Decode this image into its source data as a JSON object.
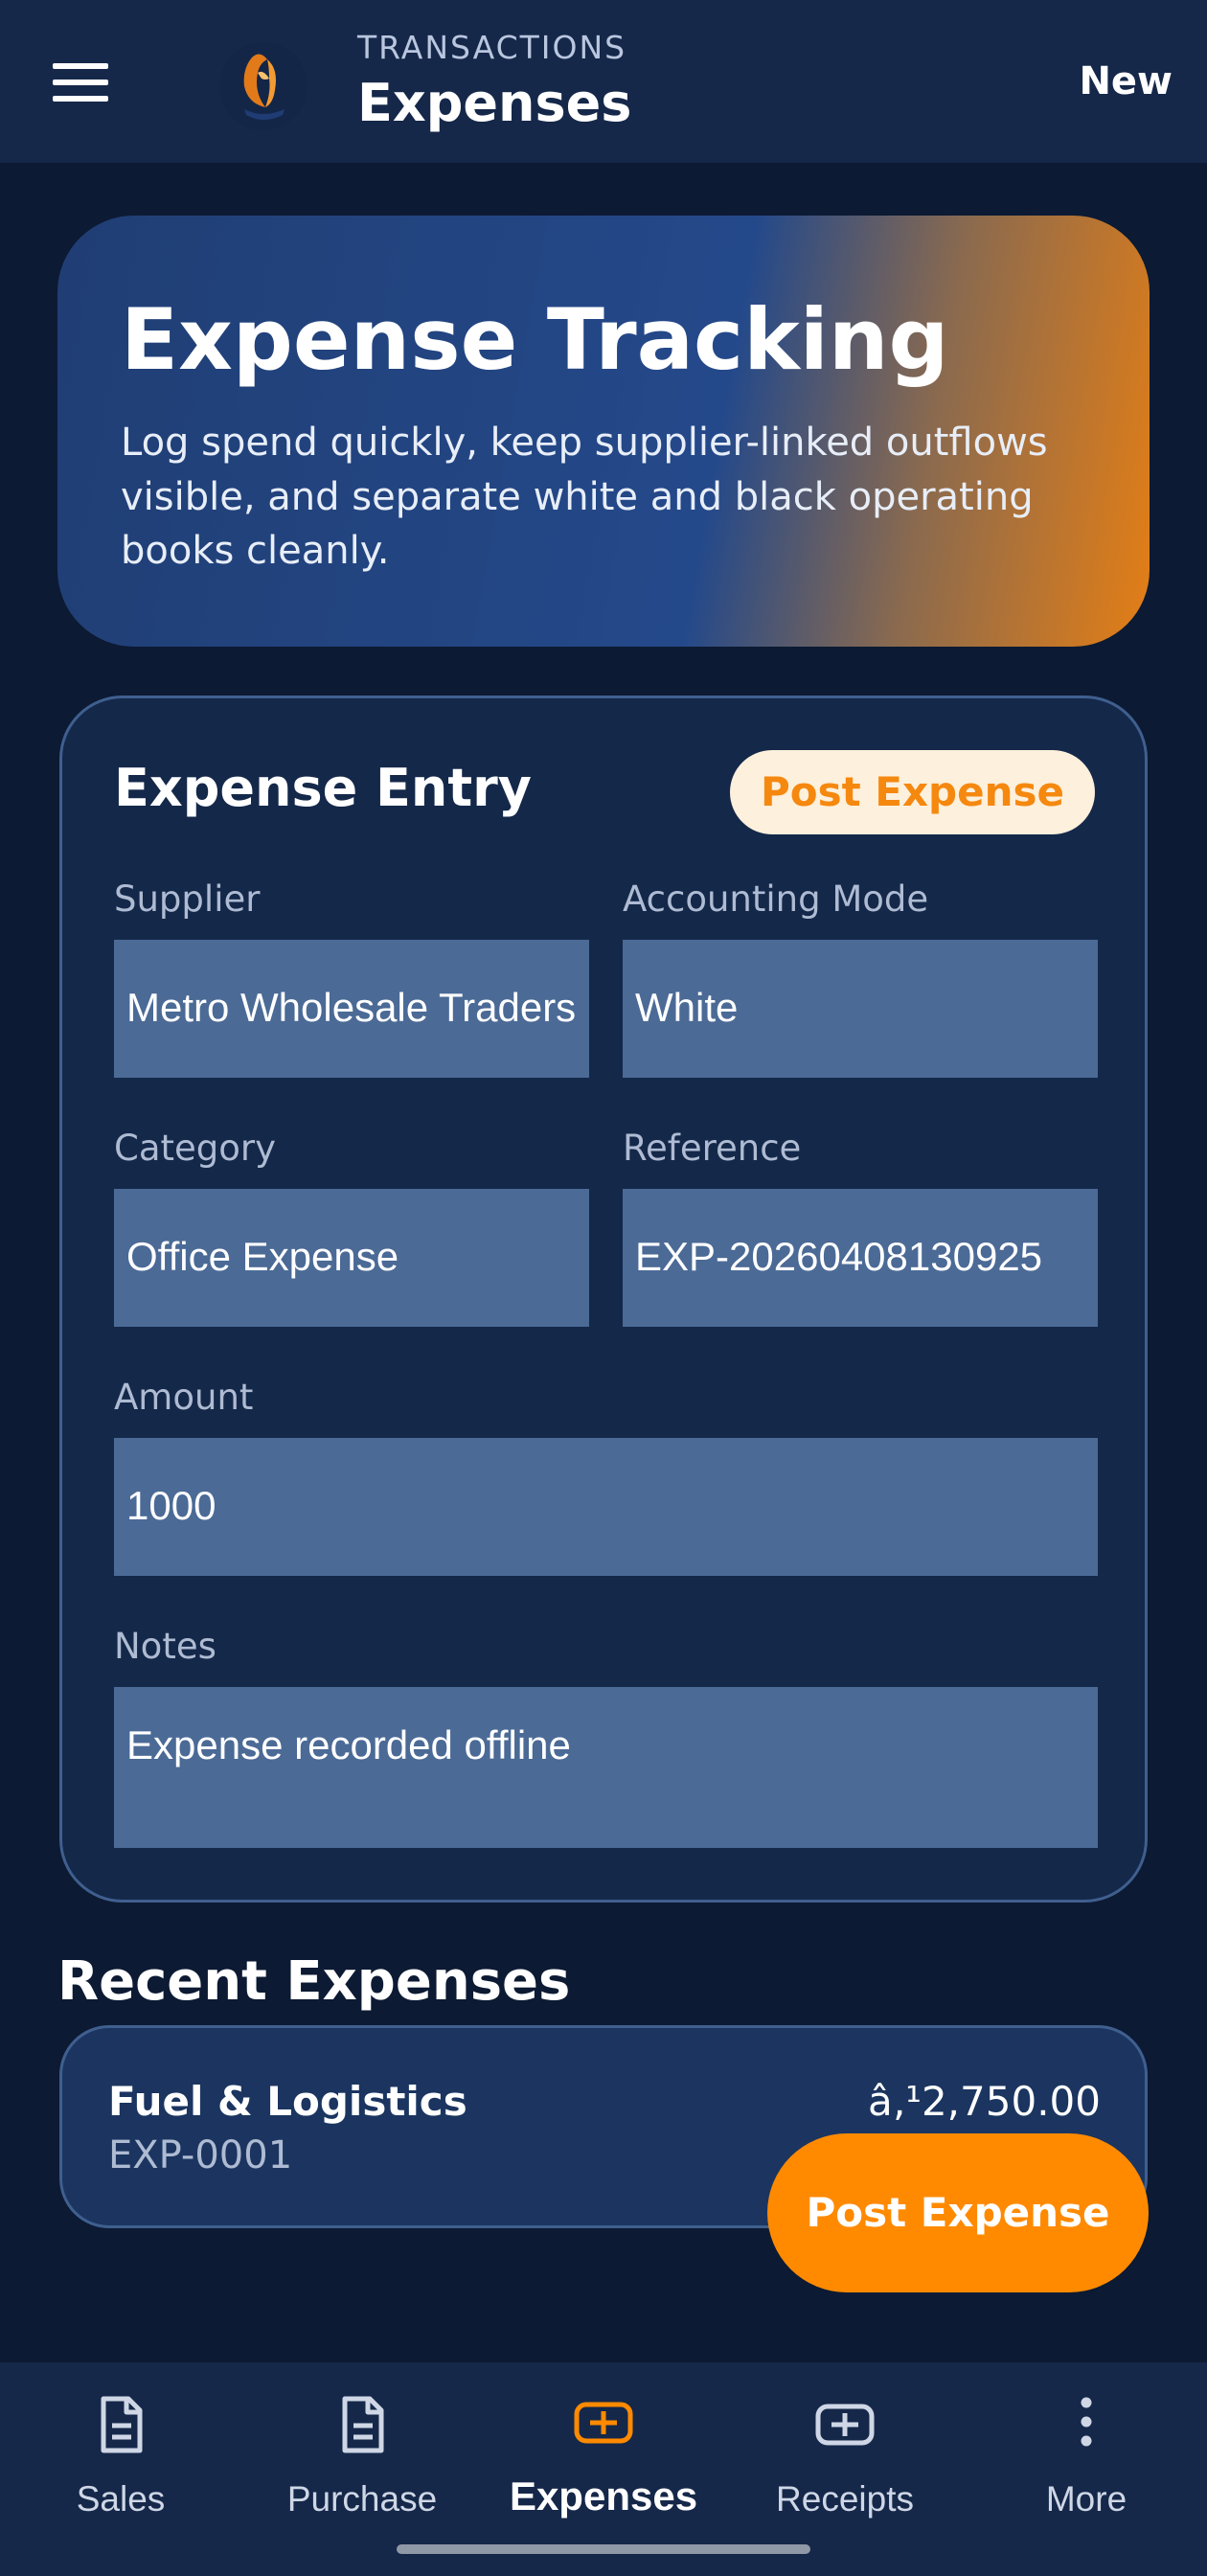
{
  "appbar": {
    "overline": "TRANSACTIONS",
    "title": "Expenses",
    "new_label": "New"
  },
  "hero": {
    "title": "Expense Tracking",
    "description": "Log spend quickly, keep supplier-linked outflows visible, and separate white and black operating books cleanly."
  },
  "entry": {
    "title": "Expense Entry",
    "post_label": "Post Expense",
    "fields": {
      "supplier": {
        "label": "Supplier",
        "value": "Metro Wholesale Traders"
      },
      "mode": {
        "label": "Accounting Mode",
        "value": "White"
      },
      "category": {
        "label": "Category",
        "value": "Office Expense"
      },
      "reference": {
        "label": "Reference",
        "value": "EXP-20260408130925"
      },
      "amount": {
        "label": "Amount",
        "value": "1000"
      },
      "notes": {
        "label": "Notes",
        "value": "Expense recorded offline"
      }
    }
  },
  "recent": {
    "title": "Recent Expenses",
    "items": [
      {
        "name": "Fuel & Logistics",
        "code": "EXP-0001",
        "amount": "â‚¹2,750.00"
      }
    ]
  },
  "fab": {
    "label": "Post Expense"
  },
  "nav": {
    "items": [
      {
        "label": "Sales",
        "icon": "document-icon"
      },
      {
        "label": "Purchase",
        "icon": "document-icon"
      },
      {
        "label": "Expenses",
        "icon": "plus-box-icon"
      },
      {
        "label": "Receipts",
        "icon": "plus-box-icon"
      },
      {
        "label": "More",
        "icon": "more-vertical-icon"
      }
    ],
    "active_index": 2
  },
  "colors": {
    "background": "#0c1a33",
    "appbar": "#15284a",
    "field": "#4b6a96",
    "accent": "#ff8a00",
    "pill": "#fdf0dc"
  }
}
